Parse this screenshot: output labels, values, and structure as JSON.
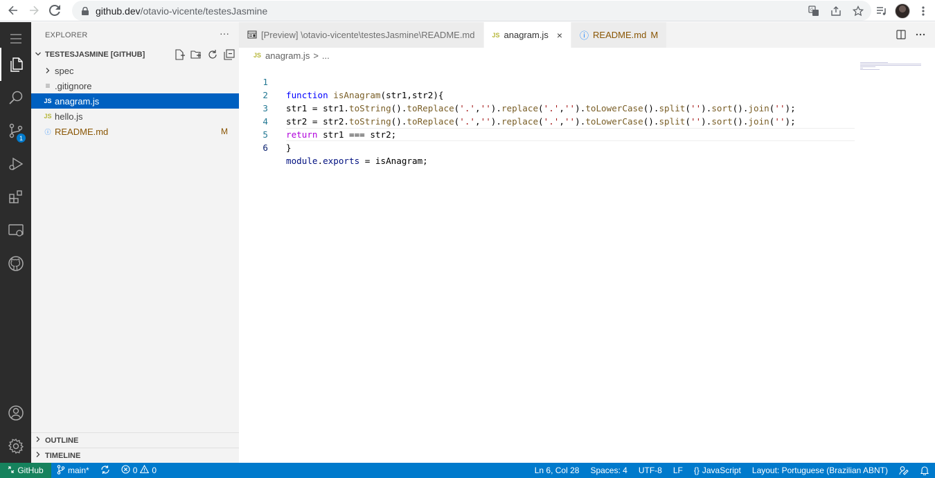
{
  "browser": {
    "url_host": "github.dev",
    "url_path": "/otavio-vicente/testesJasmine"
  },
  "activity_bar": {
    "scm_badge": "1"
  },
  "sidebar": {
    "title": "EXPLORER",
    "more": "···",
    "root_label": "TESTESJASMINE [GITHUB]",
    "items": [
      {
        "name": "spec",
        "type": "folder",
        "icon": ">"
      },
      {
        "name": ".gitignore",
        "type": "file",
        "icon": "≡"
      },
      {
        "name": "anagram.js",
        "type": "js",
        "icon": "JS",
        "selected": true
      },
      {
        "name": "hello.js",
        "type": "js",
        "icon": "JS"
      },
      {
        "name": "README.md",
        "type": "md",
        "icon": "ⓘ",
        "git_status": "M"
      }
    ],
    "outline_label": "OUTLINE",
    "timeline_label": "TIMELINE"
  },
  "tabs": [
    {
      "label": "[Preview] \\otavio-vicente\\testesJasmine\\README.md",
      "icon": "preview-icon"
    },
    {
      "label": "anagram.js",
      "icon": "JS",
      "active": true,
      "close": "×"
    },
    {
      "label": "README.md",
      "icon": "ⓘ",
      "modified": "M"
    }
  ],
  "breadcrumb": {
    "file": "anagram.js",
    "sep": ">",
    "rest": "..."
  },
  "code": {
    "line_numbers": [
      "1",
      "2",
      "3",
      "4",
      "5",
      "6"
    ],
    "l1": {
      "kw": "function",
      "fn": "isAnagram",
      "rest": "(str1,str2){"
    },
    "l2": {
      "a": "str1 = str1.",
      "f1": "toString",
      "b": "().",
      "f2": "toReplace",
      "c": "(",
      "s1": "'.'",
      "d": ",",
      "s2": "''",
      "e": ").",
      "f3": "replace",
      "g": "(",
      "s3": "'.'",
      "h": ",",
      "s4": "''",
      "i": ").",
      "f4": "toLowerCase",
      "j": "().",
      "f5": "split",
      "k": "(",
      "s5": "''",
      "l": ").",
      "f6": "sort",
      "m": "().",
      "f7": "join",
      "n": "(",
      "s6": "''",
      "o": ");"
    },
    "l3": {
      "a": "str2 = str2.",
      "f1": "toString",
      "b": "().",
      "f2": "toReplace",
      "c": "(",
      "s1": "'.'",
      "d": ",",
      "s2": "''",
      "e": ").",
      "f3": "replace",
      "g": "(",
      "s3": "'.'",
      "h": ",",
      "s4": "''",
      "i": ").",
      "f4": "toLowerCase",
      "j": "().",
      "f5": "split",
      "k": "(",
      "s5": "''",
      "l": ").",
      "f6": "sort",
      "m": "().",
      "f7": "join",
      "n": "(",
      "s6": "''",
      "o": ");"
    },
    "l4": {
      "kw": "return",
      "rest": " str1 === str2;"
    },
    "l5": {
      "rest": "}"
    },
    "l6": {
      "v1": "module",
      "dot": ".",
      "v2": "exports",
      "rest": " = isAnagram;"
    }
  },
  "status_bar": {
    "remote": "GitHub",
    "branch": "main*",
    "errors": "0",
    "warnings": "0",
    "position": "Ln 6, Col 28",
    "spaces": "Spaces: 4",
    "encoding": "UTF-8",
    "eol": "LF",
    "language": "JavaScript",
    "layout": "Layout: Portuguese (Brazilian ABNT)"
  },
  "colors": {
    "status_bar": "#007acc",
    "remote": "#16825d",
    "activity_bar": "#2c2c2c",
    "selection": "#0060c0"
  }
}
